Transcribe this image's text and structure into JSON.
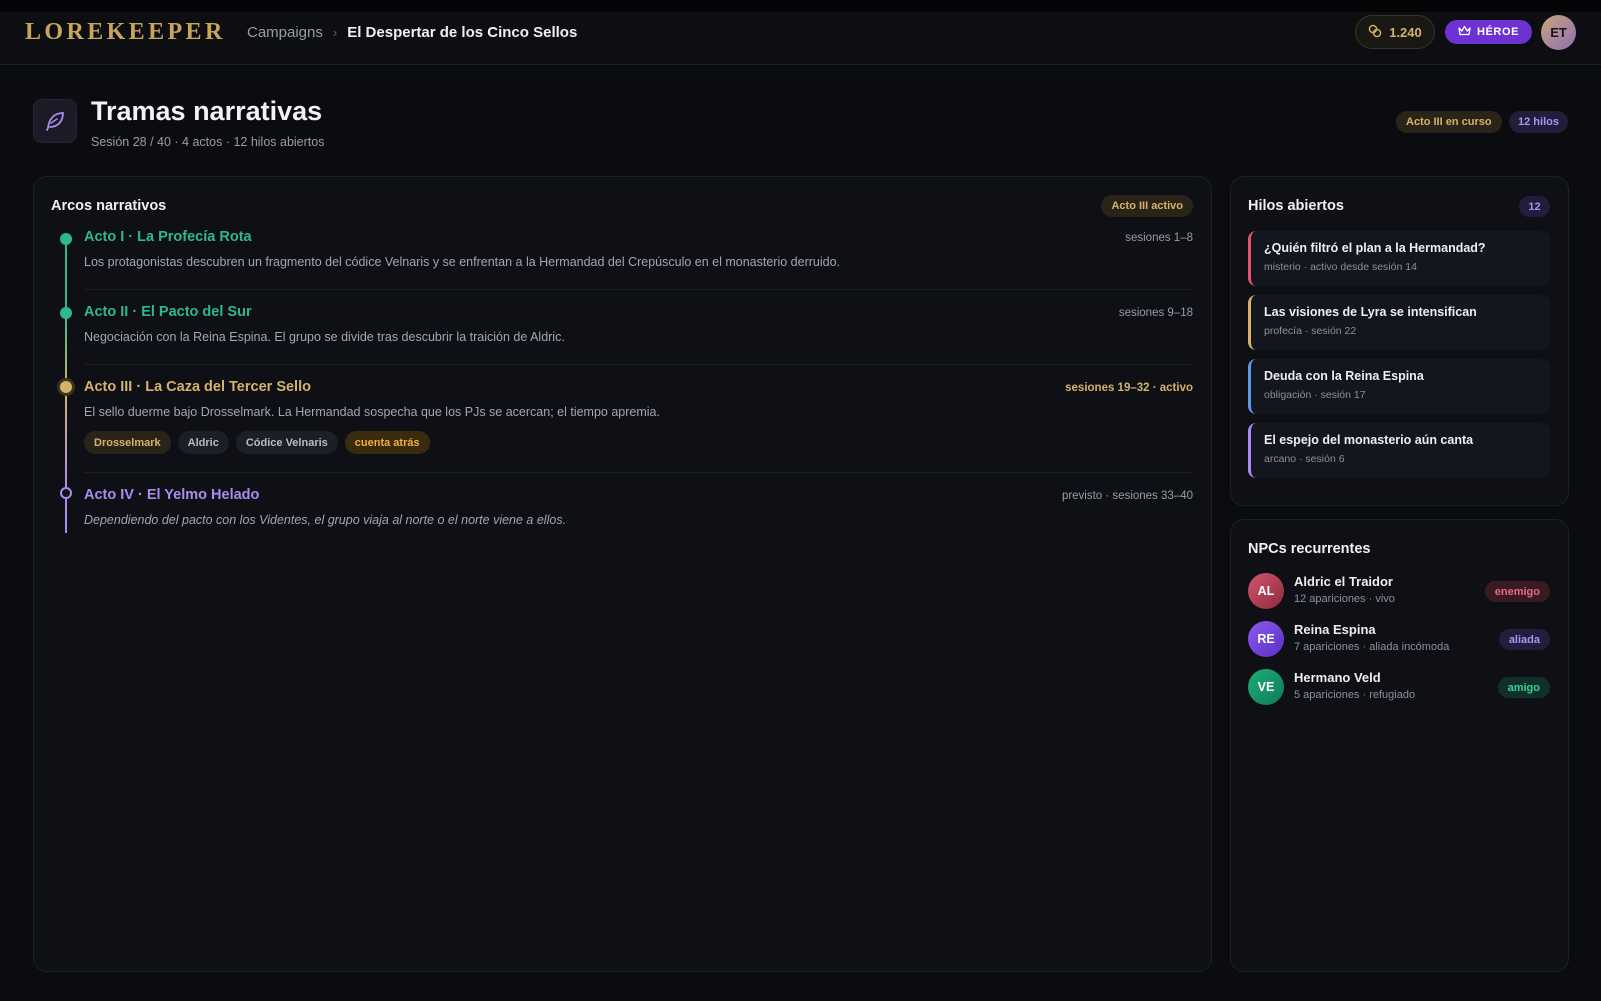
{
  "app": {
    "logo": "LOREKEEPER"
  },
  "breadcrumb": {
    "campaigns": "Campaigns",
    "separator": "›",
    "current": "El Despertar de los Cinco Sellos"
  },
  "topbar": {
    "coins": "1.240",
    "plan": "HÉROE",
    "avatar_initials": "ET"
  },
  "page": {
    "icon": "feather-icon",
    "title": "Tramas narrativas",
    "subtitle": "Sesión 28 / 40 · 4 actos · 12 hilos abiertos",
    "badge_acto": "Acto III en curso",
    "badge_hilos": "12 hilos"
  },
  "arcs": {
    "title": "Arcos narrativos",
    "badge": "Acto III activo",
    "items": [
      {
        "title": "Acto I · La Profecía Rota",
        "range": "sesiones 1–8",
        "desc": "Los protagonistas descubren un fragmento del códice Velnaris y se enfrentan a la Hermandad del Crepúsculo en el monasterio derruido.",
        "color": "#2fb98a"
      },
      {
        "title": "Acto II · El Pacto del Sur",
        "range": "sesiones 9–18",
        "desc": "Negociación con la Reina Espina. El grupo se divide tras descubrir la traición de Aldric.",
        "color": "#2fb98a"
      },
      {
        "title": "Acto III · La Caza del Tercer Sello",
        "range": "sesiones 19–32 · activo",
        "desc": "El sello duerme bajo Drosselmark. La Hermandad sospecha que los PJs se acercan; el tiempo apremia.",
        "color": "#d4b26a",
        "tags": [
          "Drosselmark",
          "Aldric",
          "Códice Velnaris",
          "cuenta atrás"
        ]
      },
      {
        "title": "Acto IV · El Yelmo Helado",
        "range": "previsto · sesiones 33–40",
        "desc": "Dependiendo del pacto con los Videntes, el grupo viaja al norte o el norte viene a ellos.",
        "color": "#a98cf0"
      }
    ]
  },
  "hilos": {
    "title": "Hilos abiertos",
    "count": "12",
    "items": [
      {
        "title": "¿Quién filtró el plan a la Hermandad?",
        "meta": "misterio · activo desde sesión 14",
        "color": "#e0566e"
      },
      {
        "title": "Las visiones de Lyra se intensifican",
        "meta": "profecía · sesión 22",
        "color": "#d4b26a"
      },
      {
        "title": "Deuda con la Reina Espina",
        "meta": "obligación · sesión 17",
        "color": "#5b9be8"
      },
      {
        "title": "El espejo del monasterio aún canta",
        "meta": "arcano · sesión 6",
        "color": "#a98cf0"
      }
    ]
  },
  "npcs": {
    "title": "NPCs recurrentes",
    "items": [
      {
        "initials": "AL",
        "name": "Aldric el Traidor",
        "meta": "12 apariciones · vivo",
        "tag": "enemigo"
      },
      {
        "initials": "RE",
        "name": "Reina Espina",
        "meta": "7 apariciones · aliada incómoda",
        "tag": "aliada"
      },
      {
        "initials": "VE",
        "name": "Hermano Veld",
        "meta": "5 apariciones · refugiado",
        "tag": "amigo"
      }
    ]
  }
}
